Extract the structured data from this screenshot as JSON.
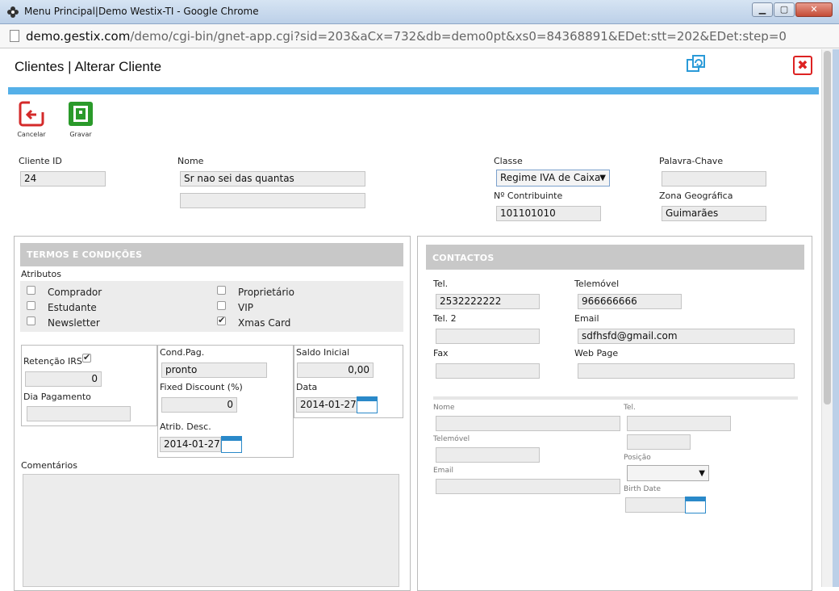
{
  "window": {
    "title": "Menu Principal|Demo Westix-TI - Google Chrome",
    "url_host": "demo.gestix.com",
    "url_path": "/demo/cgi-bin/gnet-app.cgi?sid=203&aCx=732&db=demo0pt&xs0=84368891&EDet:stt=202&EDet:step=0",
    "minimize": "▁",
    "maximize": "▢",
    "close": "✕"
  },
  "header": {
    "title": "Clientes | Alterar Cliente",
    "close_glyph": "✖"
  },
  "toolbar": {
    "cancel_label": "Cancelar",
    "save_label": "Gravar"
  },
  "client": {
    "id_label": "Cliente ID",
    "id_value": "24",
    "name_label": "Nome",
    "name_value": "Sr nao sei das quantas",
    "name2_value": "",
    "class_label": "Classe",
    "class_value": "Regime IVA de Caixa",
    "keyword_label": "Palavra-Chave",
    "keyword_value": "",
    "nif_label": "Nº Contribuinte",
    "nif_value": "101101010",
    "zone_label": "Zona Geográfica",
    "zone_value": "Guimarães"
  },
  "terms": {
    "heading": "TERMOS E CONDIÇÕES",
    "attributes_label": "Atributos",
    "attributes": [
      {
        "label": "Comprador",
        "checked": false
      },
      {
        "label": "Estudante",
        "checked": false
      },
      {
        "label": "Newsletter",
        "checked": false
      },
      {
        "label": "Proprietário",
        "checked": false
      },
      {
        "label": "VIP",
        "checked": false
      },
      {
        "label": "Xmas Card",
        "checked": true
      }
    ],
    "irs_label": "Retenção IRS",
    "irs_checked": true,
    "irs_value": "0",
    "pay_day_label": "Dia Pagamento",
    "pay_day_value": "",
    "cond_label": "Cond.Pag.",
    "cond_value": "pronto",
    "discount_label": "Fixed Discount (%)",
    "discount_value": "0",
    "atrib_label": "Atrib. Desc.",
    "atrib_value": "2014-01-27",
    "balance_label": "Saldo Inicial",
    "balance_value": "0,00",
    "date_label": "Data",
    "date_value": "2014-01-27",
    "comments_label": "Comentários"
  },
  "contacts": {
    "heading": "CONTACTOS",
    "tel_label": "Tel.",
    "tel_value": "2532222222",
    "mobile_label": "Telemóvel",
    "mobile_value": "966666666",
    "tel2_label": "Tel. 2",
    "tel2_value": "",
    "email_label": "Email",
    "email_value": "sdfhsfd@gmail.com",
    "fax_label": "Fax",
    "fax_value": "",
    "web_label": "Web Page",
    "web_value": "",
    "person": {
      "name_label": "Nome",
      "tel_label": "Tel.",
      "mobile_label": "Telemóvel",
      "position_label": "Posição",
      "email_label": "Email",
      "birth_label": "Birth Date"
    }
  },
  "colors": {
    "accent": "#55b0e8",
    "cancel": "#d42a2a",
    "save": "#2a9a2a",
    "panel_header": "#c8c8c8"
  }
}
